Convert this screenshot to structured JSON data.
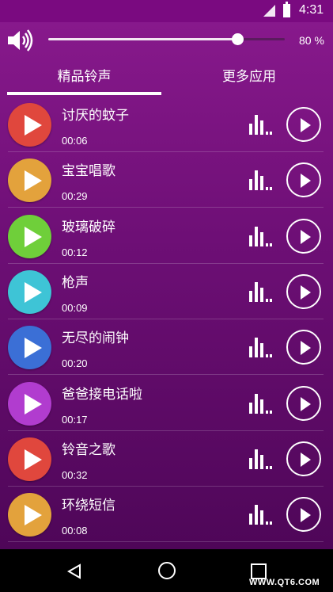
{
  "status_bar": {
    "time": "4:31"
  },
  "volume": {
    "level_percent": 80,
    "label": "80 %"
  },
  "tabs": [
    {
      "label": "精品铃声",
      "active": true
    },
    {
      "label": "更多应用",
      "active": false
    }
  ],
  "ringtones": [
    {
      "title": "讨厌的蚊子",
      "duration": "00:06",
      "color": "#e0473d"
    },
    {
      "title": "宝宝唱歌",
      "duration": "00:29",
      "color": "#e3a23c"
    },
    {
      "title": "玻璃破碎",
      "duration": "00:12",
      "color": "#6fcf3a"
    },
    {
      "title": "枪声",
      "duration": "00:09",
      "color": "#3ec4d6"
    },
    {
      "title": "无尽的闹钟",
      "duration": "00:20",
      "color": "#3b6fd6"
    },
    {
      "title": "爸爸接电话啦",
      "duration": "00:17",
      "color": "#b13ccf"
    },
    {
      "title": "铃音之歌",
      "duration": "00:32",
      "color": "#e0473d"
    },
    {
      "title": "环绕短信",
      "duration": "00:08",
      "color": "#e3a23c"
    }
  ],
  "watermark": "WWW.QT6.COM"
}
